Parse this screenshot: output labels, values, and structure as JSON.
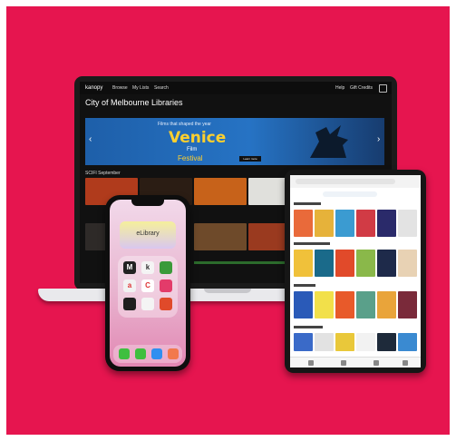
{
  "laptop": {
    "brand": "kanopy",
    "nav_items": [
      "Browse",
      "My Lists",
      "Search"
    ],
    "nav_right": [
      "Help",
      "Gift Credits"
    ],
    "library_title": "City of Melbourne Libraries",
    "banner": {
      "kicker": "Films that shaped the year",
      "title": "Venice",
      "subtitle_1": "Film",
      "subtitle_2": "Festival",
      "button": "Learn more"
    },
    "row_label": "SCIFI September"
  },
  "phone": {
    "widget_label": "eLibrary"
  },
  "colors": {
    "background": "#e6154f",
    "banner_title": "#ffd02e"
  }
}
